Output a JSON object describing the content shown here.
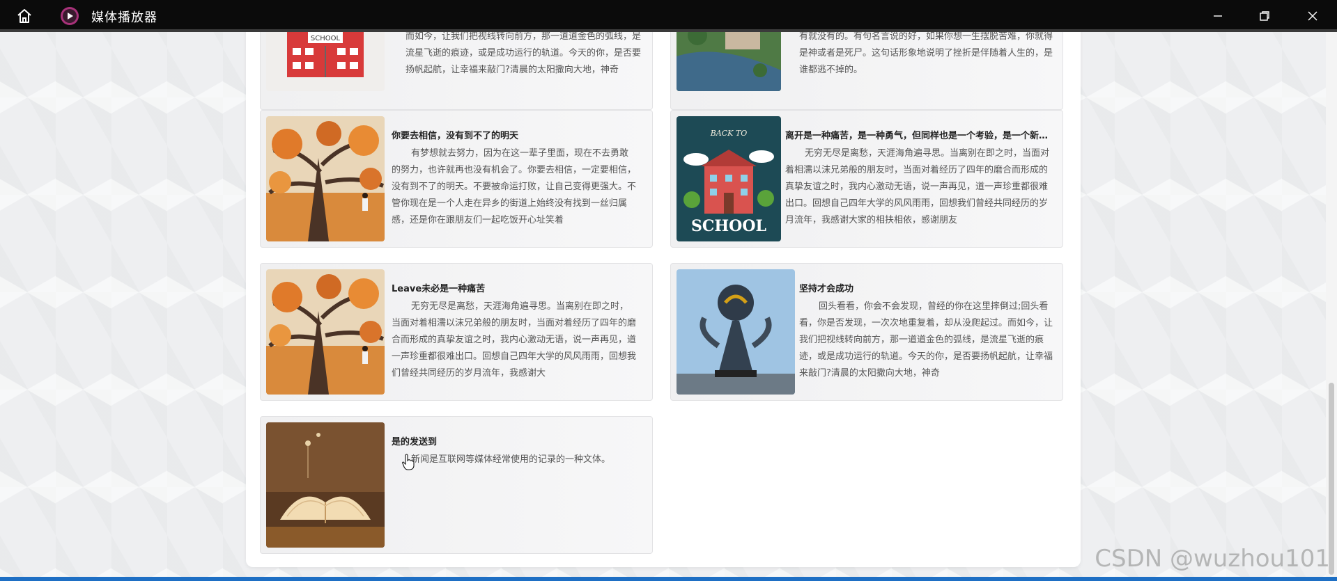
{
  "window": {
    "title": "媒体播放器",
    "home_icon": "home-icon",
    "logo_icon": "play-circle-icon",
    "controls": [
      "minimize-icon",
      "restore-icon",
      "close-icon"
    ]
  },
  "cards": {
    "top_left": {
      "body": "而如今，让我们把视线转向前方，那一道道金色的弧线，是流星飞逝的痕迹，或是成功运行的轨道。今天的你，是否要扬帆起航，让幸福来敲门?清晨的太阳撒向大地，神奇"
    },
    "top_right": {
      "body": "有就没有的。有句名言说的好，如果你想一生摆脱苦难，你就得是神或者是死尸。这句话形象地说明了挫折是伴随着人生的，是谁都逃不掉的。"
    },
    "c1": {
      "title": "你要去相信，没有到不了的明天",
      "body": "有梦想就去努力，因为在这一辈子里面，现在不去勇敢的努力，也许就再也没有机会了。你要去相信，一定要相信，没有到不了的明天。不要被命运打败，让自己变得更强大。不管你现在是一个人走在异乡的街道上始终没有找到一丝归属感，还是你在跟朋友们一起吃饭开心址笑着"
    },
    "c2": {
      "title": "离开是一种痛苦，是一种勇气，但同样也是一个考验，是一个新的开始",
      "body": "无穷无尽是离愁，天涯海角遍寻思。当离别在即之时，当面对着相濡以沫兄弟般的朋友时，当面对着经历了四年的磨合而形成的真挚友谊之时，我内心激动无语，说一声再见，道一声珍重都很难出口。回想自己四年大学的风风雨雨，回想我们曾经共同经历的岁月流年，我感谢大家的相扶相依，感谢朋友"
    },
    "c3": {
      "title": "Leave未必是一种痛苦",
      "body": "无穷无尽是离愁，天涯海角遍寻思。当离别在即之时，当面对着相濡以沫兄弟般的朋友时，当面对着经历了四年的磨合而形成的真挚友谊之时，我内心激动无语，说一声再见，道一声珍重都很难出口。回想自己四年大学的风风雨雨，回想我们曾经共同经历的岁月流年，我感谢大"
    },
    "c4": {
      "title": "坚持才会成功",
      "body": "回头看看，你会不会发现，曾经的你在这里摔倒过;回头看看，你是否发现，一次次地重复着，却从没爬起过。而如今，让我们把视线转向前方，那一道道金色的弧线，是流星飞逝的痕迹，或是成功运行的轨道。今天的你，是否要扬帆起航，让幸福来敲门?清晨的太阳撒向大地，神奇"
    },
    "c5": {
      "title": "是的发送到",
      "body": "新闻是互联网等媒体经常使用的记录的一种文体。"
    },
    "images": {
      "school_sign": "SCHOOL",
      "back_to": "BACK TO",
      "school_big": "SCHOOL"
    }
  },
  "watermark": "CSDN @wuzhou101",
  "colors": {
    "titlebar": "#0b0b0b",
    "accent": "#1e6fc4",
    "logo": "#a8327a"
  }
}
